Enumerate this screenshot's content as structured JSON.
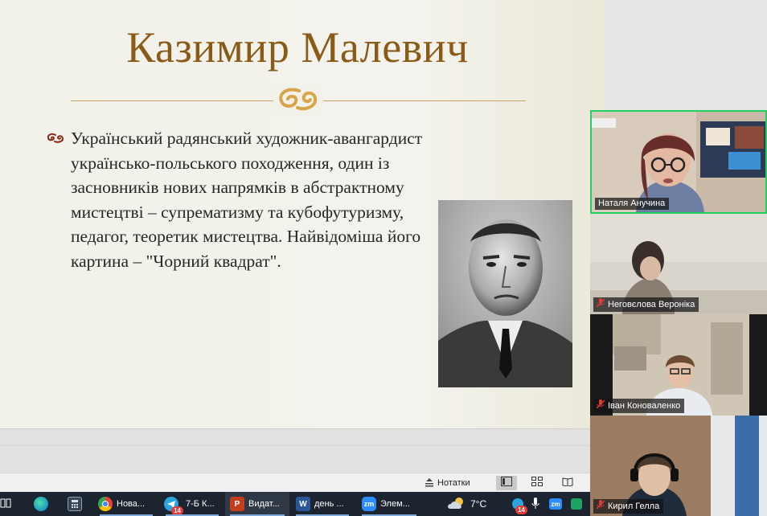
{
  "slide": {
    "title": "Казимир Малевич",
    "body": "Український радянський художник-авангардист українсько-польського походження, один із засновників нових напрямків в абстрактному мистецтві – супрематизму та кубофутуризму, педагог, теоретик мистецтва. Найвідоміша його картина – \"Чорний квадрат\".",
    "accent_color": "#8a5a17",
    "icons": {
      "bullet": "flourish-bullet-icon",
      "divider": "flourish-divider-icon"
    }
  },
  "statusbar": {
    "notes_label": "Нотатки",
    "icons": [
      "notes-icon",
      "normal-view-icon",
      "slide-sorter-icon",
      "reading-view-icon"
    ]
  },
  "taskbar": {
    "items": [
      {
        "label": "Нова...",
        "icon": "chrome-icon"
      },
      {
        "label": "7-Б К...",
        "icon": "telegram-icon",
        "badge": "14"
      },
      {
        "label": "Видат...",
        "icon": "powerpoint-icon"
      },
      {
        "label": "день ...",
        "icon": "word-icon"
      },
      {
        "label": "Элем...",
        "icon": "zoom-icon"
      }
    ],
    "pinned_icons": [
      "task-view-icon",
      "edge-icon",
      "calculator-icon"
    ],
    "weather": {
      "temperature": "7°C",
      "icon": "weather-cloud-icon"
    },
    "tray": {
      "telegram_badge": "14",
      "icons": [
        "telegram-tray-icon",
        "microphone-icon",
        "zoom-tray-icon",
        "tray-app-icon"
      ]
    }
  },
  "participants": [
    {
      "name": "Наталя Анучина",
      "muted": false,
      "speaking": true
    },
    {
      "name": "Неговєлова Вероніка",
      "muted": true,
      "speaking": false
    },
    {
      "name": "Іван Коноваленко",
      "muted": true,
      "speaking": false
    },
    {
      "name": "Кирил Гелла",
      "muted": true,
      "speaking": false
    }
  ],
  "colors": {
    "speaking_border": "#1fd15f",
    "taskbar": "#1c2430",
    "muted_icon": "#e53935"
  }
}
